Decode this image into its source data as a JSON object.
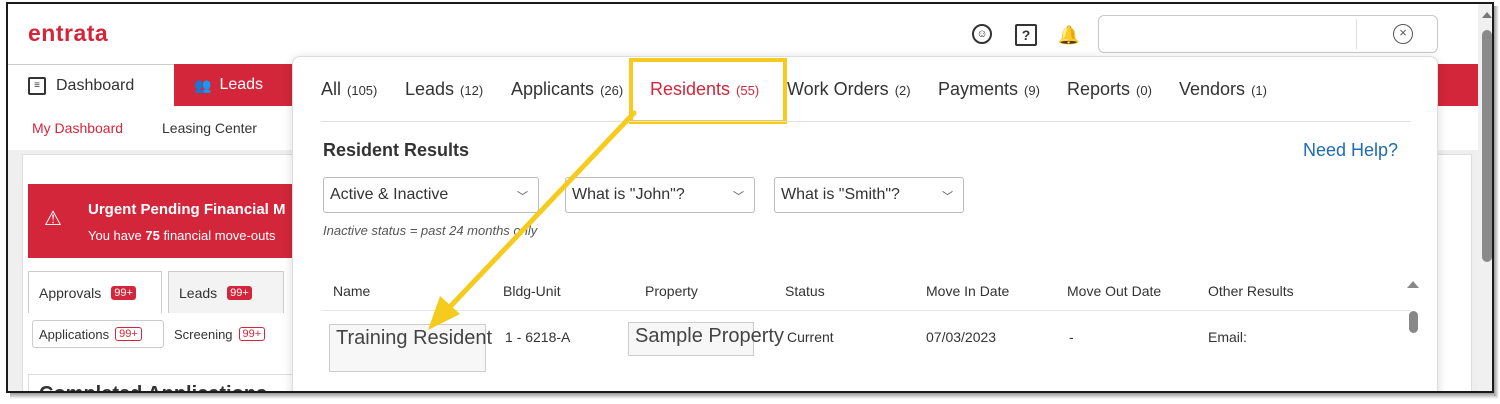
{
  "header": {
    "logo": "entrata",
    "search_value": ""
  },
  "nav": {
    "dashboard_label": "Dashboard",
    "leads_label": "Leads",
    "sub_items": [
      "My Dashboard",
      "Leasing Center"
    ]
  },
  "background": {
    "urgent_title": "Urgent Pending Financial M",
    "urgent_text_pre": "You have ",
    "urgent_count": "75",
    "urgent_text_post": " financial move-outs",
    "tabs": [
      {
        "label": "Approvals",
        "badge": "99+"
      },
      {
        "label": "Leads",
        "badge": "99+"
      }
    ],
    "chips": [
      {
        "label": "Applications",
        "badge": "99+"
      },
      {
        "label": "Screening",
        "badge": "99+"
      }
    ],
    "completed_title": "Completed Applications"
  },
  "search_popup": {
    "tabs": [
      {
        "label": "All",
        "count": "(105)"
      },
      {
        "label": "Leads",
        "count": "(12)"
      },
      {
        "label": "Applicants",
        "count": "(26)"
      },
      {
        "label": "Residents",
        "count": "(55)"
      },
      {
        "label": "Work Orders",
        "count": "(2)"
      },
      {
        "label": "Payments",
        "count": "(9)"
      },
      {
        "label": "Reports",
        "count": "(0)"
      },
      {
        "label": "Vendors",
        "count": "(1)"
      }
    ],
    "active_tab": "Residents",
    "section_title": "Resident Results",
    "need_help": "Need Help?",
    "filters": {
      "status": "Active & Inactive",
      "first_name_placeholder": "What is \"John\"?",
      "last_name_placeholder": "What is \"Smith\"?"
    },
    "hint": "Inactive status = past 24 months only",
    "columns": [
      "Name",
      "Bldg-Unit",
      "Property",
      "Status",
      "Move In Date",
      "Move Out Date",
      "Other Results"
    ],
    "rows": [
      {
        "name": "Training Resident",
        "bldg_unit": "1 - 6218-A",
        "property": "Sample Property",
        "status": "Current",
        "move_in": "07/03/2023",
        "move_out": "-",
        "other": "Email:"
      }
    ]
  },
  "colors": {
    "brand_red": "#d3263a",
    "highlight_yellow": "#f5cc1d",
    "link_blue": "#1f6bb4"
  }
}
